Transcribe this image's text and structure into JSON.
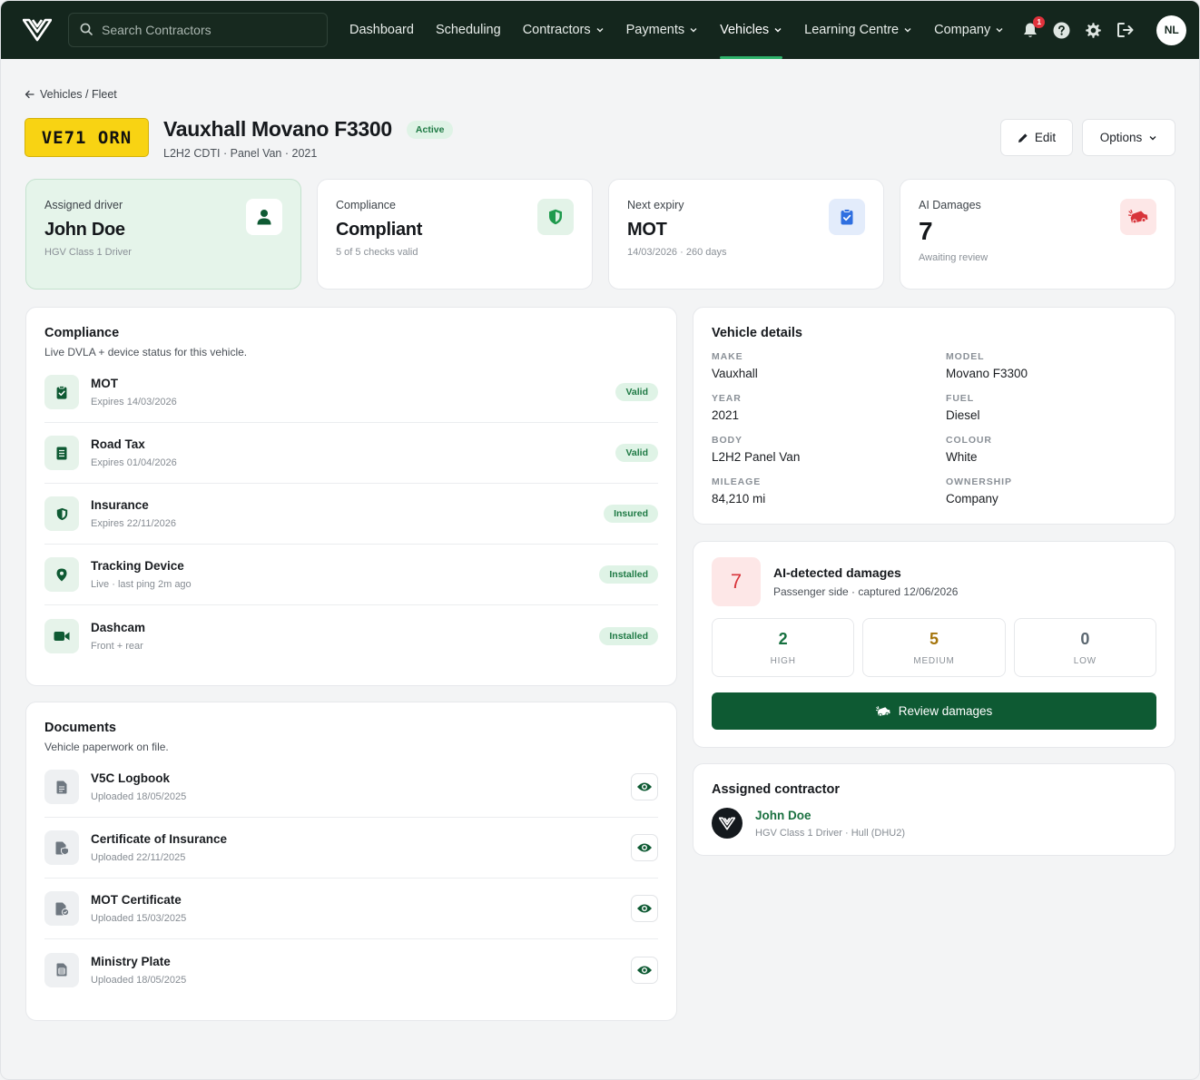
{
  "nav": {
    "search_placeholder": "Search Contractors",
    "links": [
      {
        "label": "Dashboard"
      },
      {
        "label": "Scheduling"
      },
      {
        "label": "Contractors"
      },
      {
        "label": "Payments"
      },
      {
        "label": "Vehicles"
      },
      {
        "label": "Learning Centre"
      },
      {
        "label": "Company"
      }
    ],
    "notification_count": "1",
    "user_initials": "NL"
  },
  "breadcrumb": "Vehicles / Fleet",
  "vehicle": {
    "plate": "VE71 ORN",
    "title": "Vauxhall Movano F3300",
    "status": "Active",
    "subtitle": "L2H2 CDTI · Panel Van · 2021"
  },
  "actions": {
    "edit": "Edit",
    "options": "Options"
  },
  "stats": {
    "driver": {
      "label": "Assigned driver",
      "value": "John Doe",
      "sub": "HGV Class 1 Driver"
    },
    "compliance": {
      "label": "Compliance",
      "value": "Compliant",
      "sub": "5 of 5 checks valid"
    },
    "expiry": {
      "label": "Next expiry",
      "value": "MOT",
      "sub": "14/03/2026 · 260 days"
    },
    "damages": {
      "label": "AI Damages",
      "value": "7",
      "sub": "Awaiting review"
    }
  },
  "compliance": {
    "title": "Compliance",
    "desc": "Live DVLA + device status for this vehicle.",
    "items": [
      {
        "title": "MOT",
        "sub": "Expires 14/03/2026",
        "status": "Valid"
      },
      {
        "title": "Road Tax",
        "sub": "Expires 01/04/2026",
        "status": "Valid"
      },
      {
        "title": "Insurance",
        "sub": "Expires 22/11/2026",
        "status": "Insured"
      },
      {
        "title": "Tracking Device",
        "sub": "Live · last ping 2m ago",
        "status": "Installed"
      },
      {
        "title": "Dashcam",
        "sub": "Front + rear",
        "status": "Installed"
      }
    ]
  },
  "documents": {
    "title": "Documents",
    "desc": "Vehicle paperwork on file.",
    "items": [
      {
        "title": "V5C Logbook",
        "sub": "Uploaded 18/05/2025"
      },
      {
        "title": "Certificate of Insurance",
        "sub": "Uploaded 22/11/2025"
      },
      {
        "title": "MOT Certificate",
        "sub": "Uploaded 15/03/2025"
      },
      {
        "title": "Ministry Plate",
        "sub": "Uploaded 18/05/2025"
      }
    ]
  },
  "details": {
    "title": "Vehicle details",
    "fields": [
      {
        "label": "MAKE",
        "value": "Vauxhall"
      },
      {
        "label": "MODEL",
        "value": "Movano F3300"
      },
      {
        "label": "YEAR",
        "value": "2021"
      },
      {
        "label": "FUEL",
        "value": "Diesel"
      },
      {
        "label": "BODY",
        "value": "L2H2 Panel Van"
      },
      {
        "label": "COLOUR",
        "value": "White"
      },
      {
        "label": "MILEAGE",
        "value": "84,210 mi"
      },
      {
        "label": "OWNERSHIP",
        "value": "Company"
      }
    ]
  },
  "ai_damages": {
    "count": "7",
    "title": "AI-detected damages",
    "sub": "Passenger side · captured 12/06/2026",
    "severity": [
      {
        "num": "2",
        "label": "HIGH",
        "color": "#16703f"
      },
      {
        "num": "5",
        "label": "MEDIUM",
        "color": "#a5750c"
      },
      {
        "num": "0",
        "label": "LOW",
        "color": "#5b6770"
      }
    ],
    "button": "Review damages"
  },
  "contractor": {
    "title": "Assigned contractor",
    "name": "John Doe",
    "sub": "HGV Class 1 Driver · Hull (DHU2)"
  },
  "colors": {
    "nav_bg": "#14261d",
    "accent": "#0e5a33",
    "plate": "#f8d313",
    "success_bg": "#dff3e6",
    "danger": "#d8353b"
  }
}
